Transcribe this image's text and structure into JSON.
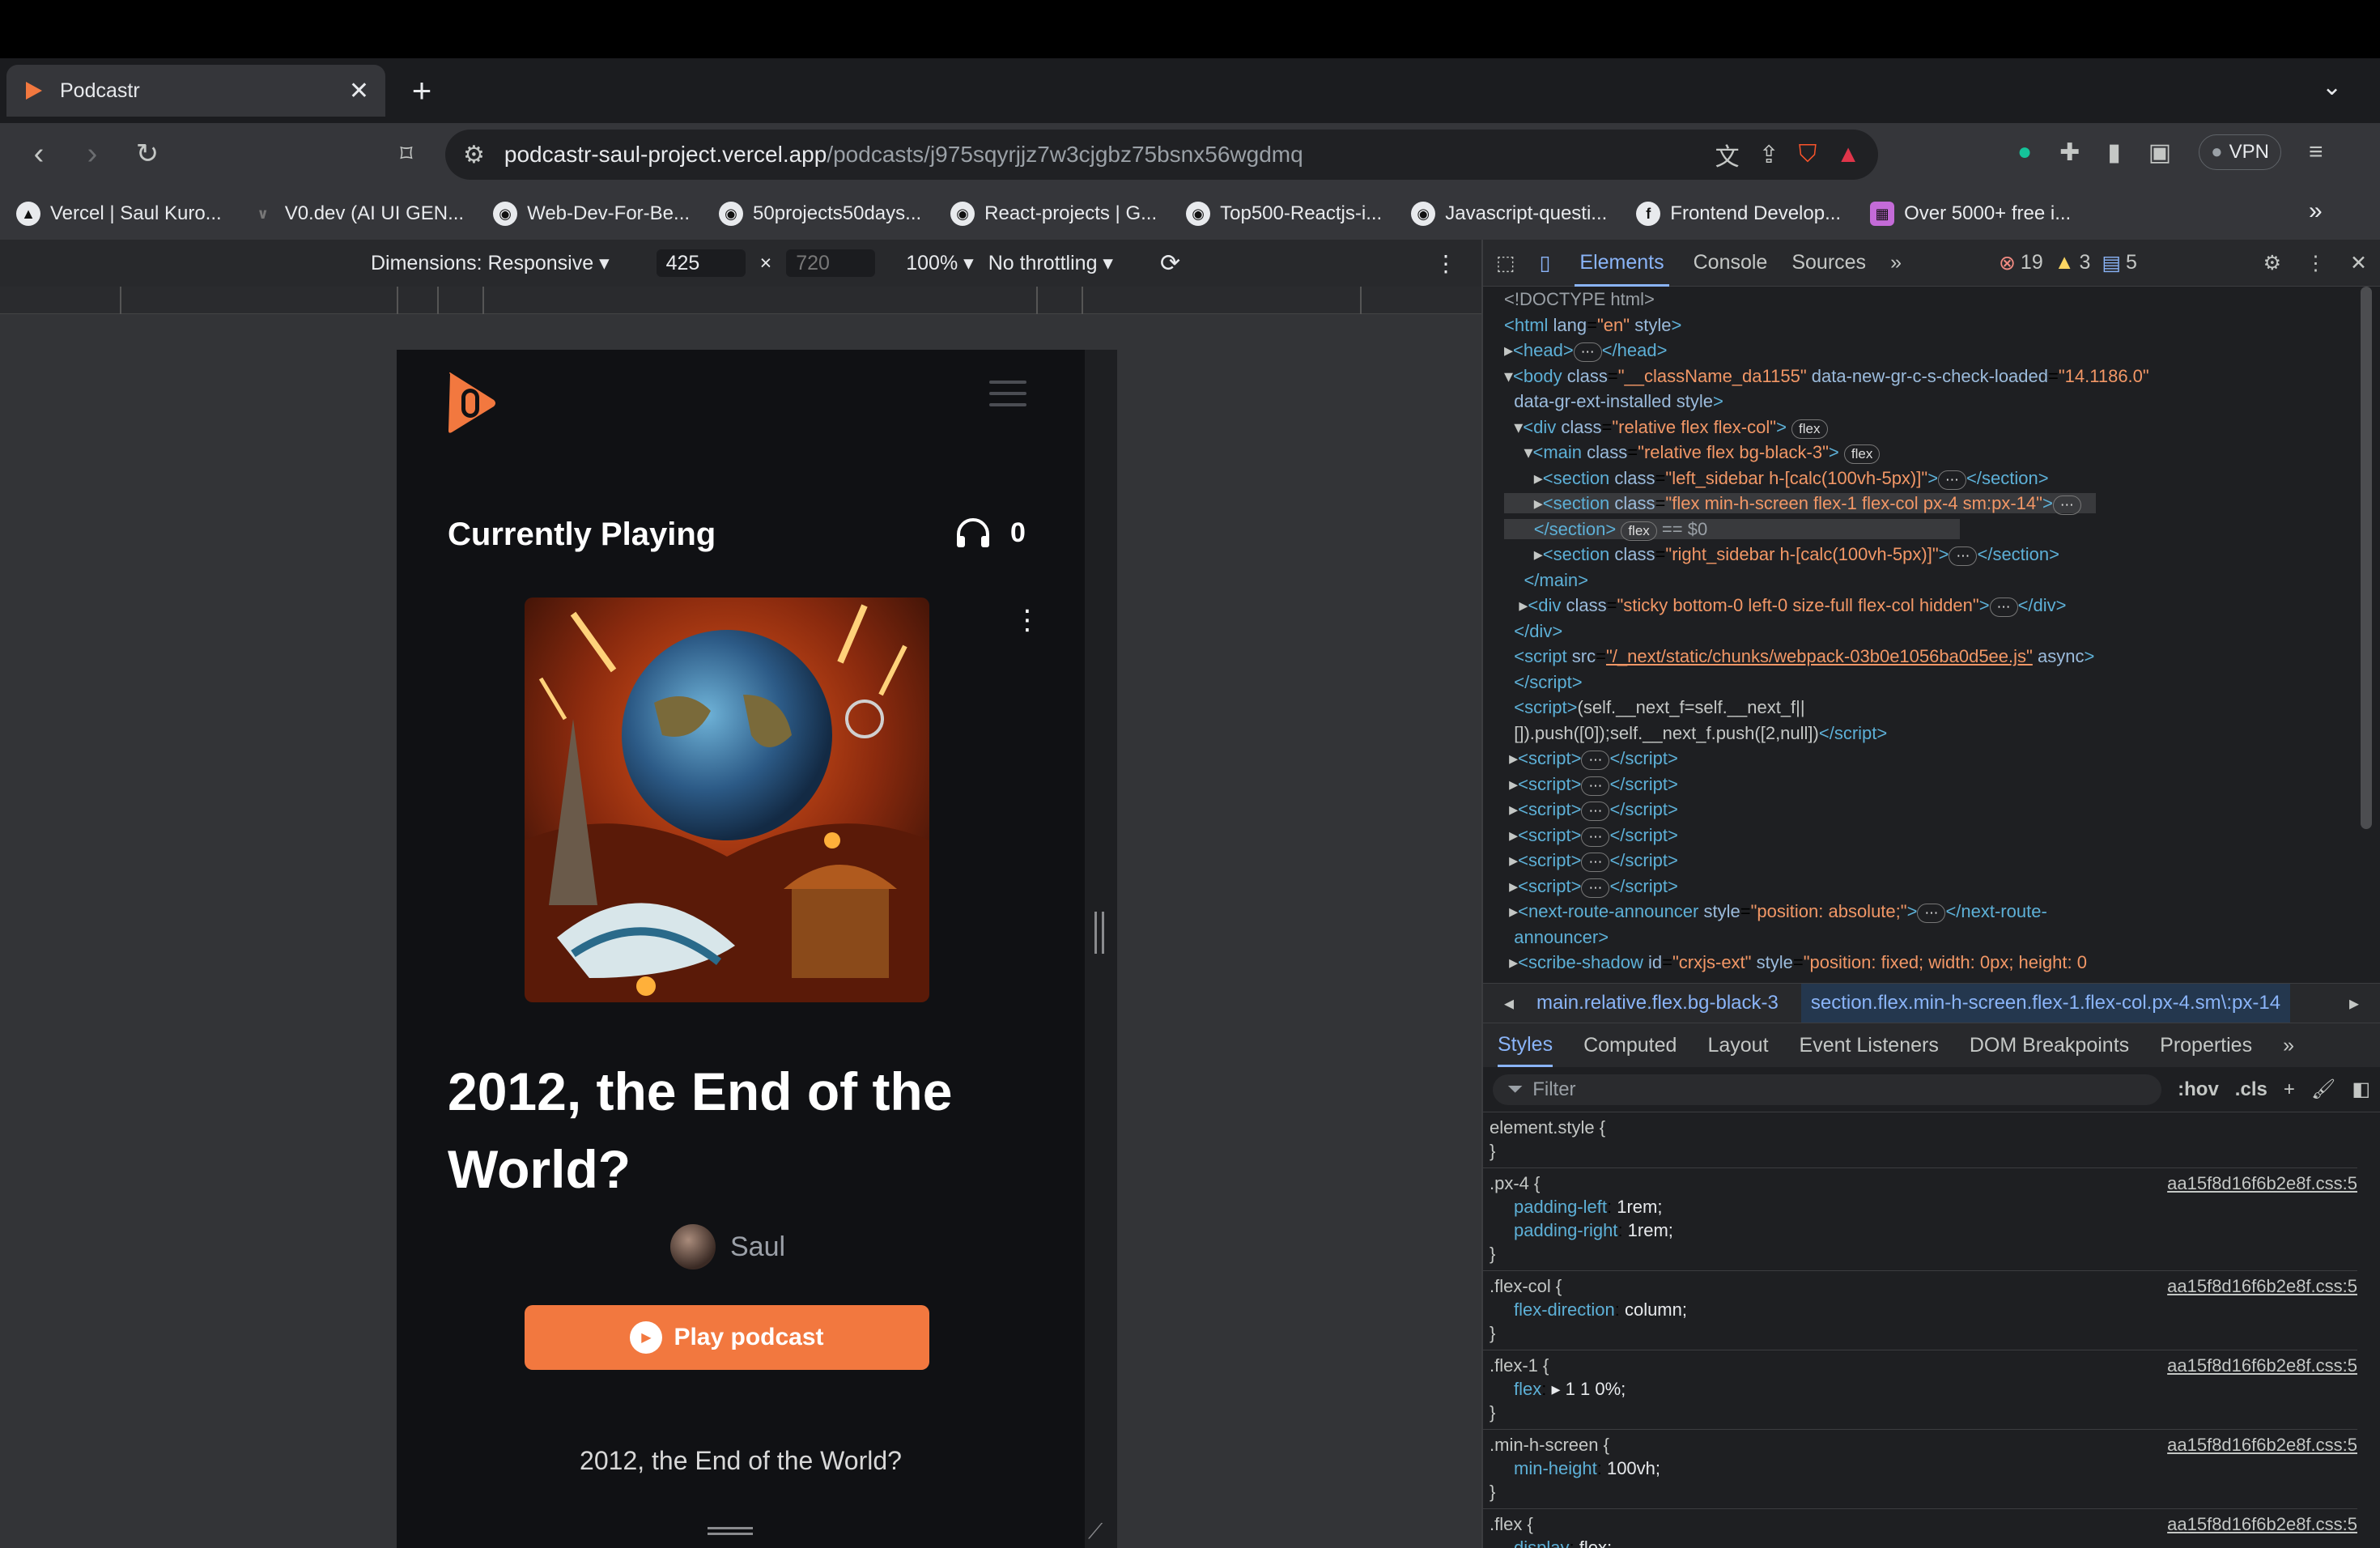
{
  "browser": {
    "tab_title": "Podcastr",
    "url_host": "podcastr-saul-project.vercel.app",
    "url_path": "/podcasts/j975sqyrjjz7w3cjgbz75bsnx56wgdmq",
    "vpn_label": "VPN",
    "bookmarks": [
      {
        "label": "Vercel | Saul Kuro...",
        "icon": "▲"
      },
      {
        "label": "V0.dev (AI UI GEN...",
        "icon": "v0"
      },
      {
        "label": "Web-Dev-For-Be...",
        "icon": "gh"
      },
      {
        "label": "50projects50days...",
        "icon": "gh"
      },
      {
        "label": "React-projects | G...",
        "icon": "gh"
      },
      {
        "label": "Top500-Reactjs-i...",
        "icon": "gh"
      },
      {
        "label": "Javascript-questi...",
        "icon": "gh"
      },
      {
        "label": "Frontend Develop...",
        "icon": "f"
      },
      {
        "label": "Over 5000+ free i...",
        "icon": "img"
      }
    ]
  },
  "device_toolbar": {
    "dimensions_label": "Dimensions: Responsive",
    "width": "425",
    "times": "×",
    "height": "720",
    "zoom": "100%",
    "throttling": "No throttling"
  },
  "app": {
    "section_title": "Currently Playing",
    "listener_count": "0",
    "podcast_title": "2012, the End of the World?",
    "author": "Saul",
    "play_button": "Play podcast",
    "description": "2012, the End of the World?"
  },
  "devtools": {
    "tabs": [
      "Elements",
      "Console",
      "Sources"
    ],
    "errors": "19",
    "warnings": "3",
    "messages": "5",
    "breadcrumb": [
      "main.relative.flex.bg-black-3",
      "section.flex.min-h-screen.flex-1.flex-col.px-4.sm\\:px-14"
    ],
    "subtabs": [
      "Styles",
      "Computed",
      "Layout",
      "Event Listeners",
      "DOM Breakpoints",
      "Properties"
    ],
    "filter_placeholder": "Filter",
    "hov": ":hov",
    "cls": ".cls",
    "css_source": "aa15f8d16f6b2e8f.css:5"
  },
  "colors": {
    "accent": "#f2783f",
    "app_bg": "#101114",
    "devtools_link": "#8ab4f8"
  }
}
